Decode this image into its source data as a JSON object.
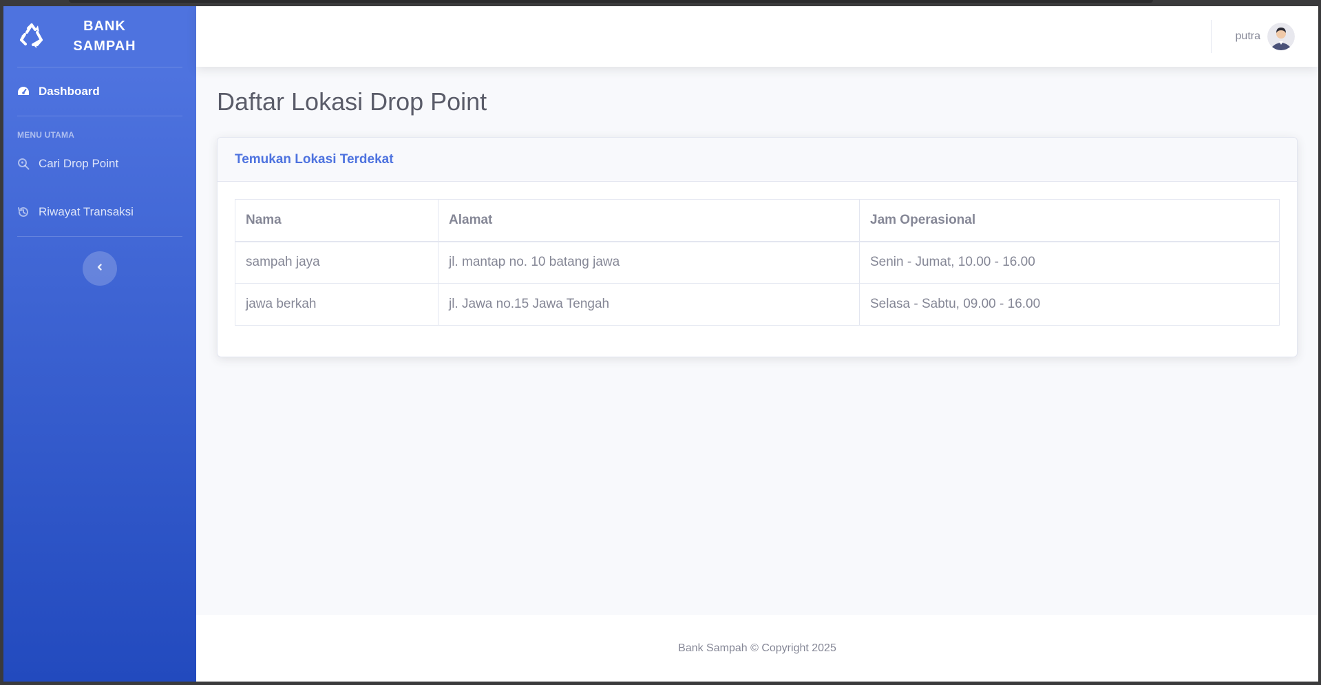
{
  "brand": {
    "line1": "BANK",
    "line2": "SAMPAH",
    "icon": "recycle-icon"
  },
  "sidebar": {
    "dashboard": {
      "label": "Dashboard",
      "icon": "tachometer-icon"
    },
    "section_heading": "MENU UTAMA",
    "items": [
      {
        "label": "Cari Drop Point",
        "icon": "search-location-icon"
      },
      {
        "label": "Riwayat Transaksi",
        "icon": "history-icon"
      }
    ],
    "toggle_icon": "chevron-left-icon"
  },
  "topbar": {
    "user_name": "putra"
  },
  "page": {
    "title": "Daftar Lokasi Drop Point",
    "card_title": "Temukan Lokasi Terdekat",
    "table": {
      "headers": [
        "Nama",
        "Alamat",
        "Jam Operasional"
      ],
      "rows": [
        [
          "sampah jaya",
          "jl. mantap no. 10 batang jawa",
          "Senin - Jumat, 10.00 - 16.00"
        ],
        [
          "jawa berkah",
          "jl. Jawa no.15 Jawa Tengah",
          "Selasa - Sabtu, 09.00 - 16.00"
        ]
      ]
    }
  },
  "footer": {
    "text": "Bank Sampah © Copyright 2025"
  },
  "colors": {
    "primary": "#4e73df",
    "primary_dark": "#224abe",
    "text_gray": "#858796",
    "title_gray": "#5a5c69"
  }
}
